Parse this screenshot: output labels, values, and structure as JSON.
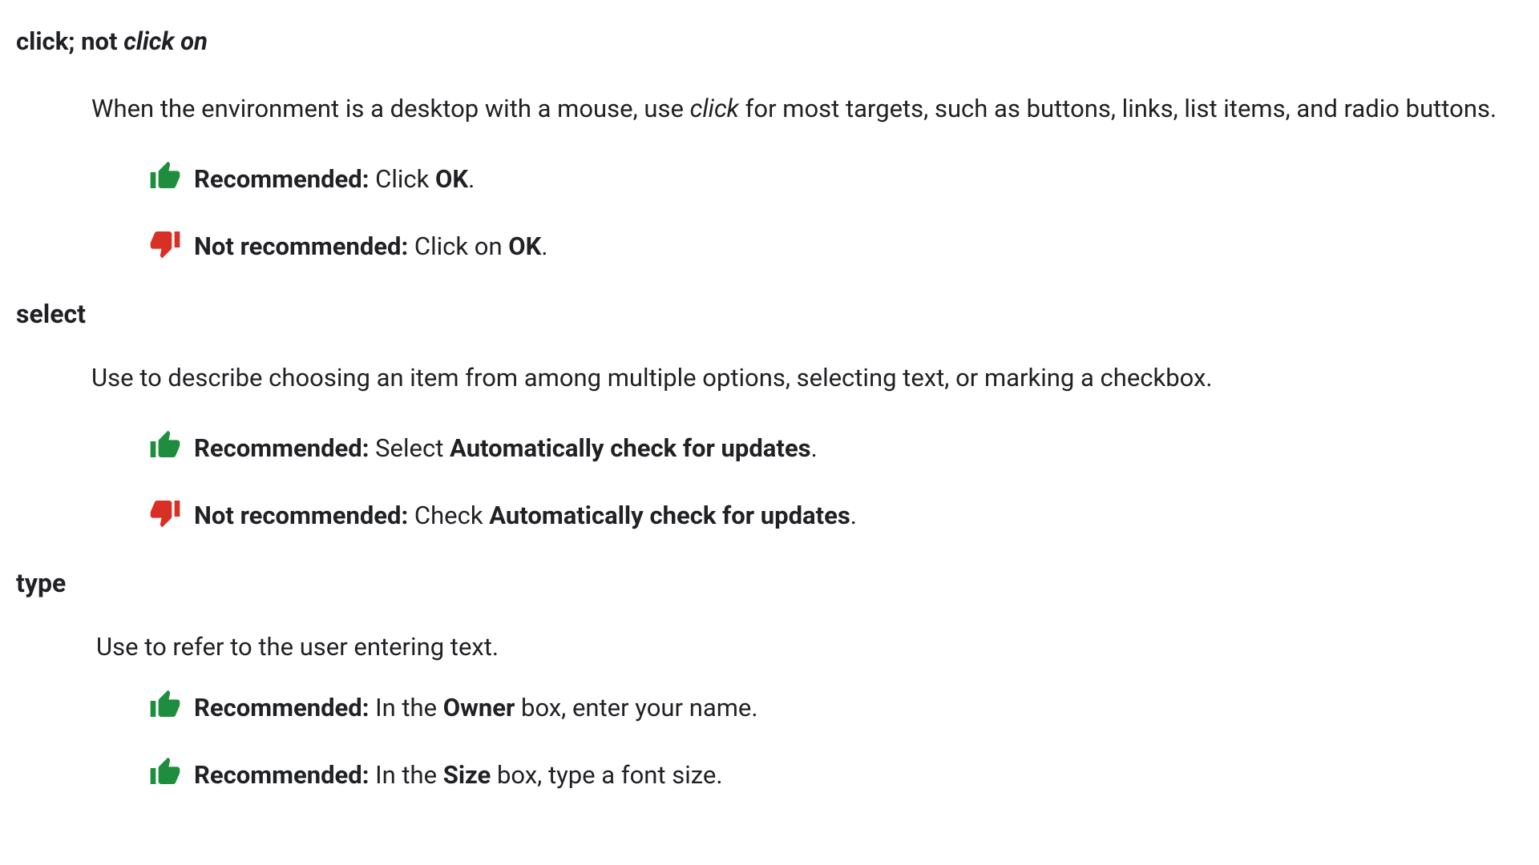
{
  "labels": {
    "recommended": "Recommended:",
    "not_recommended": "Not recommended:"
  },
  "sections": [
    {
      "title_parts": [
        {
          "text": "click; not ",
          "style": "normal"
        },
        {
          "text": "click on",
          "style": "italic"
        }
      ],
      "desc_parts": [
        {
          "text": "When the environment is a desktop with a mouse, use ",
          "style": "normal"
        },
        {
          "text": "click",
          "style": "italic"
        },
        {
          "text": " for most targets, such as buttons, links, list items, and radio buttons.",
          "style": "normal"
        }
      ],
      "examples": [
        {
          "kind": "recommended",
          "body": [
            {
              "text": " Click ",
              "style": "normal"
            },
            {
              "text": "OK",
              "style": "bold"
            },
            {
              "text": ".",
              "style": "normal"
            }
          ]
        },
        {
          "kind": "not_recommended",
          "body": [
            {
              "text": " Click on ",
              "style": "normal"
            },
            {
              "text": "OK",
              "style": "bold"
            },
            {
              "text": ".",
              "style": "normal"
            }
          ]
        }
      ]
    },
    {
      "title_parts": [
        {
          "text": "select",
          "style": "normal"
        }
      ],
      "desc_parts": [
        {
          "text": "Use to describe choosing an item from among multiple options, selecting text, or marking a checkbox.",
          "style": "normal"
        }
      ],
      "examples": [
        {
          "kind": "recommended",
          "body": [
            {
              "text": " Select ",
              "style": "normal"
            },
            {
              "text": "Automatically check for updates",
              "style": "bold"
            },
            {
              "text": ".",
              "style": "normal"
            }
          ]
        },
        {
          "kind": "not_recommended",
          "body": [
            {
              "text": " Check ",
              "style": "normal"
            },
            {
              "text": "Automatically check for updates",
              "style": "bold"
            },
            {
              "text": ".",
              "style": "normal"
            }
          ]
        }
      ]
    },
    {
      "title_parts": [
        {
          "text": "type",
          "style": "normal"
        }
      ],
      "desc_class": "desc-type",
      "desc_parts": [
        {
          "text": "Use to refer to the user entering text.",
          "style": "normal"
        }
      ],
      "examples": [
        {
          "kind": "recommended",
          "body": [
            {
              "text": " In the ",
              "style": "normal"
            },
            {
              "text": "Owner",
              "style": "bold"
            },
            {
              "text": " box, enter your name.",
              "style": "normal"
            }
          ]
        },
        {
          "kind": "recommended",
          "body": [
            {
              "text": " In the ",
              "style": "normal"
            },
            {
              "text": "Size",
              "style": "bold"
            },
            {
              "text": " box, type a font size.",
              "style": "normal"
            }
          ]
        }
      ]
    }
  ]
}
